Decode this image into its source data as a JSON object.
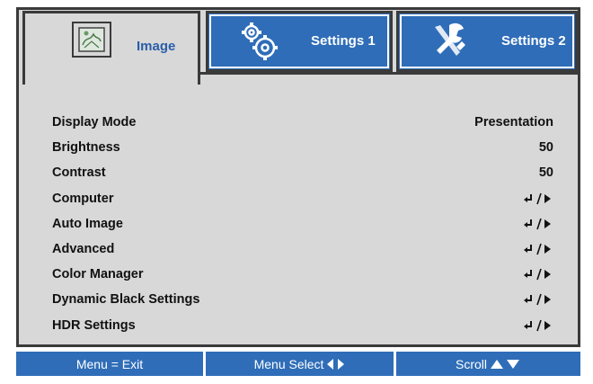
{
  "tabs": [
    {
      "label": "Image",
      "icon": "image-icon"
    },
    {
      "label": "Settings 1",
      "icon": "gears-icon"
    },
    {
      "label": "Settings 2",
      "icon": "tools-icon"
    }
  ],
  "menu": [
    {
      "label": "Display Mode",
      "value": "Presentation"
    },
    {
      "label": "Brightness",
      "value": "50"
    },
    {
      "label": "Contrast",
      "value": "50"
    },
    {
      "label": "Computer",
      "value": "",
      "icon": "enter-arrow-icon"
    },
    {
      "label": "Auto Image",
      "value": "",
      "icon": "enter-arrow-icon"
    },
    {
      "label": "Advanced",
      "value": "",
      "icon": "enter-arrow-icon"
    },
    {
      "label": "Color Manager",
      "value": "",
      "icon": "enter-arrow-icon"
    },
    {
      "label": "Dynamic Black Settings",
      "value": "",
      "icon": "enter-arrow-icon"
    },
    {
      "label": "HDR Settings",
      "value": "",
      "icon": "enter-arrow-icon"
    }
  ],
  "footer": {
    "exit": "Menu = Exit",
    "select": "Menu Select",
    "scroll": "Scroll"
  },
  "colors": {
    "accent_blue": "#2f6db8",
    "panel_gray": "#d8d8d8",
    "border_dark": "#3a3a3a"
  }
}
